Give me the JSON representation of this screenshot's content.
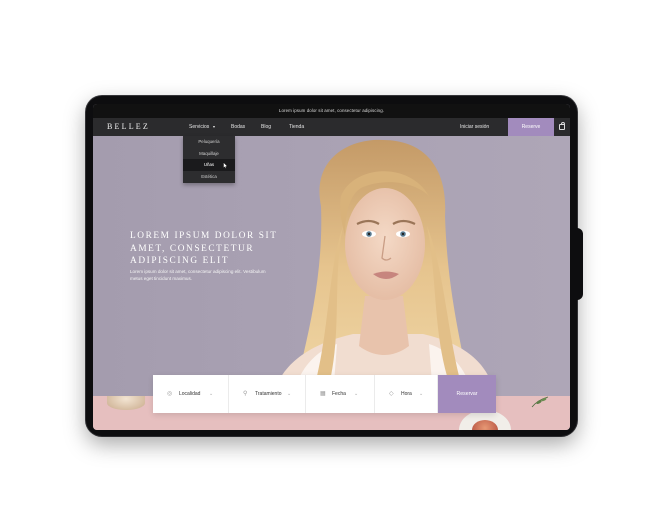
{
  "topbar": {
    "text": "Lorem ipsum dolor sit amet, consectetur adipiscing."
  },
  "nav": {
    "logo": "BELLEZ",
    "items": [
      {
        "label": "Servicios",
        "has_caret": true
      },
      {
        "label": "Bodas"
      },
      {
        "label": "Blog"
      },
      {
        "label": "Tienda"
      }
    ],
    "login_label": "Iniciar sesión",
    "reserve_label": "Reserve"
  },
  "dropdown": {
    "items": [
      {
        "label": "Peluquería"
      },
      {
        "label": "Maquillaje"
      },
      {
        "label": "Uñas",
        "active": true
      },
      {
        "label": "Estética"
      }
    ]
  },
  "hero": {
    "title": "LOREM IPSUM DOLOR SIT AMET, CONSECTETUR ADIPISCING ELIT",
    "text": "Lorem ipsum dolor sit amet, consectetur adipiscing elit. Vestibulum metus eget tincidunt maximus."
  },
  "booking": {
    "fields": [
      {
        "label": "Localidad",
        "icon": "location-icon"
      },
      {
        "label": "Tratamiento",
        "icon": "pin-icon"
      },
      {
        "label": "Fecha",
        "icon": "calendar-icon"
      },
      {
        "label": "Hora",
        "icon": "clock-icon"
      }
    ],
    "button_label": "Reservar"
  },
  "colors": {
    "accent": "#a28bbd",
    "hero_bg": "#a59daf",
    "nav_bg": "#2b2b2d",
    "strip_bg": "#e6bfbf"
  }
}
